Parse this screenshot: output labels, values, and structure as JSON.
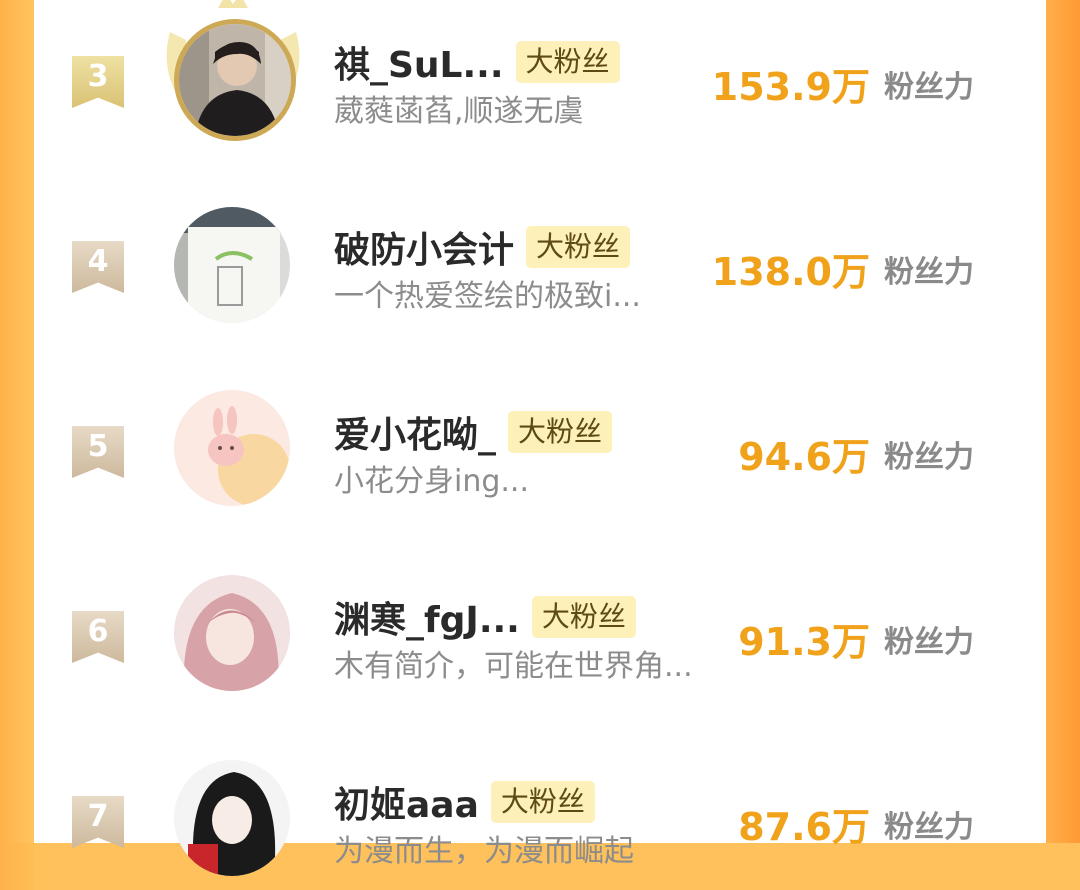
{
  "ranking": {
    "score_suffix_label": "粉丝力",
    "entries": [
      {
        "rank": "3",
        "name": "祺_SuL...",
        "badge": "大粉丝",
        "bio": "葳蕤菡萏,顺遂无虞",
        "score": "153.9万",
        "highlight": true
      },
      {
        "rank": "4",
        "name": "破防小会计",
        "badge": "大粉丝",
        "bio": "一个热爱签绘的极致i...",
        "score": "138.0万",
        "highlight": false
      },
      {
        "rank": "5",
        "name": "爱小花呦_",
        "badge": "大粉丝",
        "bio": "小花分身ing...",
        "score": "94.6万",
        "highlight": false
      },
      {
        "rank": "6",
        "name": "渊寒_fgJ...",
        "badge": "大粉丝",
        "bio": "木有简介，可能在世界角...",
        "score": "91.3万",
        "highlight": false
      },
      {
        "rank": "7",
        "name": "初姬aaa",
        "badge": "大粉丝",
        "bio": "为漫而生，为漫而崛起",
        "score": "87.6万",
        "highlight": false
      }
    ]
  },
  "colors": {
    "frame": "#ffc15b",
    "score": "#f0a21a",
    "badge_bg": "#fdf0b8",
    "rank_badge": "#cdb99d",
    "rank_badge_top": "#d9c274",
    "avatar_ring_top": "#cda955"
  }
}
